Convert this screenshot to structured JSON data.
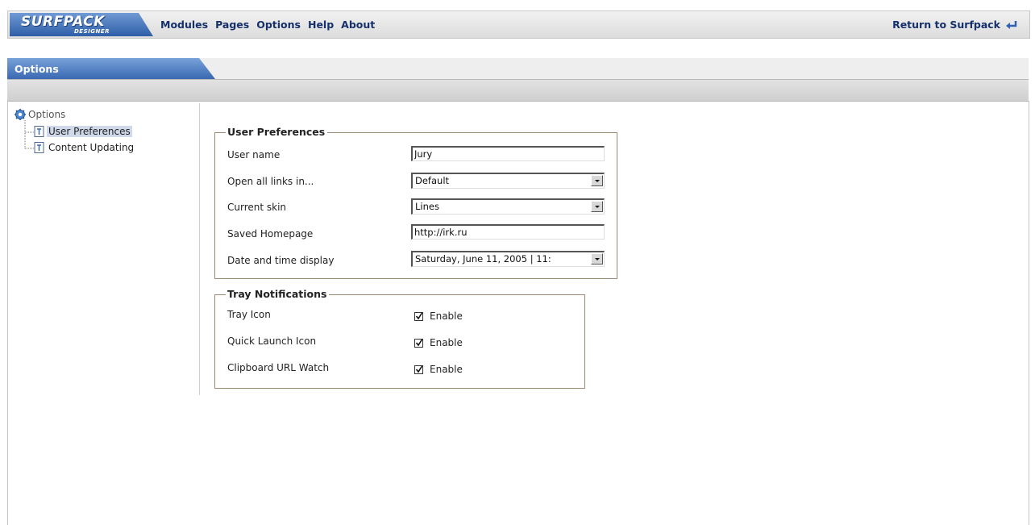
{
  "header": {
    "logo_main": "SURFPACK",
    "logo_sub": "DESIGNER",
    "menu": [
      "Modules",
      "Pages",
      "Options",
      "Help",
      "About"
    ],
    "return_label": "Return to Surfpack"
  },
  "tabs": {
    "active": "Options"
  },
  "tree": {
    "root": "Options",
    "items": [
      "User Preferences",
      "Content Updating"
    ],
    "selected": "User Preferences"
  },
  "user_preferences": {
    "title": "User Preferences",
    "user_name_label": "User name",
    "user_name_value": "Jury",
    "open_links_label": "Open all links in...",
    "open_links_value": "Default",
    "skin_label": "Current skin",
    "skin_value": "Lines",
    "homepage_label": "Saved Homepage",
    "homepage_value": "http://irk.ru",
    "datetime_label": "Date and time display",
    "datetime_value": "Saturday, June 11, 2005 | 11:"
  },
  "tray_notifications": {
    "title": "Tray Notifications",
    "items": [
      {
        "label": "Tray Icon",
        "check_label": "Enable",
        "checked": true
      },
      {
        "label": "Quick Launch Icon",
        "check_label": "Enable",
        "checked": true
      },
      {
        "label": "Clipboard URL Watch",
        "check_label": "Enable",
        "checked": true
      }
    ]
  },
  "colors": {
    "accent_blue": "#3a69b3",
    "menu_text": "#15306a",
    "fieldset_border": "#9b8a72",
    "selection": "#cfd9ea"
  }
}
